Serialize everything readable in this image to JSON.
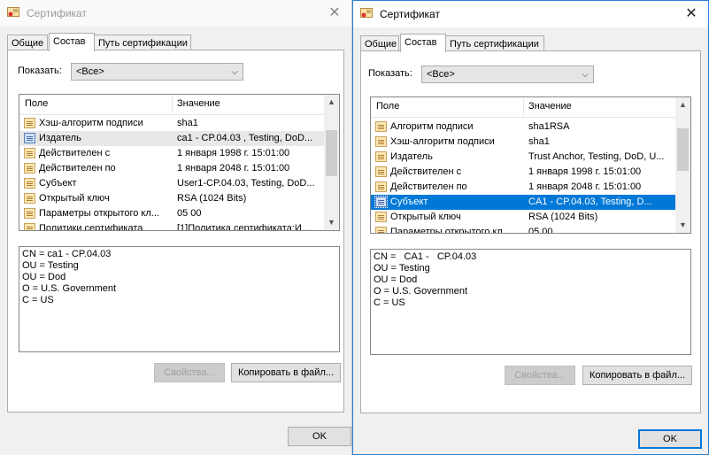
{
  "dialogs": [
    {
      "title": "Сертификат",
      "tabs": [
        "Общие",
        "Состав",
        "Путь сертификации"
      ],
      "show_label": "Показать:",
      "show_value": "<Все>",
      "columns": [
        "Поле",
        "Значение"
      ],
      "rows": [
        {
          "field": "Хэш-алгоритм подписи",
          "value": "sha1"
        },
        {
          "field": "Издатель",
          "value": "ca1 - CP.04.03 , Testing, DoD..."
        },
        {
          "field": "Действителен с",
          "value": "1 января 1998 г. 15:01:00"
        },
        {
          "field": "Действителен по",
          "value": "1 января 2048 г. 15:01:00"
        },
        {
          "field": "Субъект",
          "value": "User1-CP.04.03, Testing, DoD..."
        },
        {
          "field": "Открытый ключ",
          "value": "RSA (1024 Bits)"
        },
        {
          "field": "Параметры открытого кл...",
          "value": "05 00"
        },
        {
          "field": "Политики сертификата",
          "value": "[1]Политика сертификата:И..."
        }
      ],
      "details": [
        "CN = ca1 - CP.04.03",
        "OU = Testing",
        "OU = Dod",
        "O = U.S. Government",
        "C = US"
      ],
      "btn_properties": "Свойства...",
      "btn_copy": "Копировать в файл...",
      "btn_ok": "OK"
    },
    {
      "title": "Сертификат",
      "tabs": [
        "Общие",
        "Состав",
        "Путь сертификации"
      ],
      "show_label": "Показать:",
      "show_value": "<Все>",
      "columns": [
        "Поле",
        "Значение"
      ],
      "rows": [
        {
          "field": "Алгоритм подписи",
          "value": "sha1RSA"
        },
        {
          "field": "Хэш-алгоритм подписи",
          "value": "sha1"
        },
        {
          "field": "Издатель",
          "value": "Trust Anchor, Testing, DoD, U..."
        },
        {
          "field": "Действителен с",
          "value": "1 января 1998 г. 15:01:00"
        },
        {
          "field": "Действителен по",
          "value": "1 января 2048 г. 15:01:00"
        },
        {
          "field": "Субъект",
          "value": "CA1 -   CP.04.03, Testing, D..."
        },
        {
          "field": "Открытый ключ",
          "value": "RSA (1024 Bits)"
        },
        {
          "field": "Параметры открытого кл...",
          "value": "05 00"
        }
      ],
      "details": [
        "CN =   CA1 -   CP.04.03",
        "OU = Testing",
        "OU = Dod",
        "O = U.S. Government",
        "C = US"
      ],
      "btn_properties": "Свойства...",
      "btn_copy": "Копировать в файл...",
      "btn_ok": "OK"
    }
  ]
}
